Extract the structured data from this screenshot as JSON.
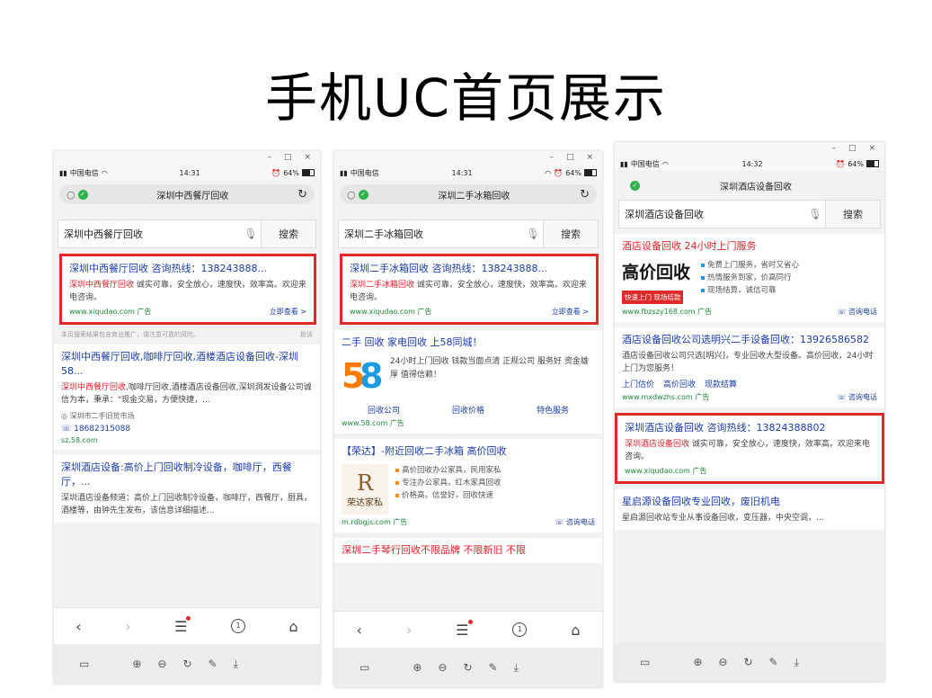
{
  "slide_title": "手机UC首页展示",
  "window_controls": {
    "min": "–",
    "max": "□",
    "close": "×"
  },
  "phones": [
    {
      "status": {
        "carrier": "中国电信",
        "time": "14:31",
        "battery": "64%"
      },
      "addr": "深圳中西餐厅回收",
      "search": {
        "query": "深圳中西餐厅回收",
        "button": "搜索"
      },
      "ad1": {
        "title": "深圳中西餐厅回收 咨询热线：138243888...",
        "desc_red": "深圳中西餐厅回收",
        "desc": " 诚实可靠，安全放心，速度快，效率高。欢迎来电咨询。",
        "url": "www.xiqudao.com",
        "ad": "广告",
        "link": "立即查看 >"
      },
      "notice": {
        "text": "本页搜索结果包含商业推广，请注意可靠的风险。",
        "action": "投诉"
      },
      "r2": {
        "title": "深圳中西餐厅回收,咖啡厅回收,酒楼酒店设备回收-深圳58...",
        "desc_red": "深圳中西餐厅回收",
        "desc": ",咖啡厅回收,酒楼酒店设备回收,深圳洞发设备公司诚信为本，秉承：\"现金交易，方便快捷，...",
        "loc": "深圳市二手旧货市场",
        "phone": "18682315088",
        "url": "sz.58.com"
      },
      "r3": {
        "title": "深圳酒店设备:高价上门回收制冷设备，咖啡厅，西餐厅，...",
        "desc": "深圳酒店设备频道：高价上门回收制冷设备，咖啡厅，西餐厅，厨具，酒楼等，由钟先生发布，该信息详细描述..."
      }
    },
    {
      "status": {
        "carrier": "中国电信",
        "time": "14:31",
        "battery": "64%"
      },
      "addr": "深圳二手冰箱回收",
      "search": {
        "query": "深圳二手冰箱回收",
        "button": "搜索"
      },
      "ad1": {
        "title": "深圳二手冰箱回收 咨询热线：138243888...",
        "desc_red": "深圳二手冰箱回收",
        "desc": " 诚实可靠，安全放心，速度快，效率高。欢迎来电咨询。",
        "url": "www.xiqudao.com",
        "ad": "广告",
        "link": "立即查看 >"
      },
      "r2": {
        "title": "二手 回收 家电回收 上58同城！",
        "desc": "24小时上门回收 钱款当面点清 正规公司 服务好 资金雄厚 值得信赖！",
        "links": [
          "回收公司",
          "回收价格",
          "特色服务"
        ],
        "url": "www.58.com",
        "ad": "广告"
      },
      "r3": {
        "title": "【荣达】-附近回收二手冰箱 高价回收",
        "logo_text": "荣达家私",
        "bullets": [
          "高价回收办公家具，民用家私",
          "专注办公家具，红木家具回收",
          "价格高，信誉好，回收快速"
        ],
        "url": "m.rdbgjs.com",
        "ad": "广告",
        "call": "咨询电话"
      },
      "r4": {
        "title": "深圳二手琴行回收不限品牌 不限新旧 不限"
      }
    },
    {
      "status": {
        "carrier": "中国电信",
        "time": "14:32",
        "battery": "64%"
      },
      "addr": "深圳酒店设备回收",
      "search": {
        "query": "深圳酒店设备回收",
        "button": "搜索"
      },
      "r1": {
        "title": "酒店设备回收 24小时上门服务",
        "big": "高价回收",
        "tag": "快速上门 现场结款",
        "bullets": [
          "免费上门服务，省时又省心",
          "热情服务到家，价高同行",
          "现场结算，诚信可靠"
        ],
        "url": "www.fbzszy168.com",
        "ad": "广告",
        "call": "咨询电话"
      },
      "r2": {
        "title": "酒店设备回收公司选明兴二手设备回收：13926586582",
        "desc": "酒店设备回收公司只选[明兴]，专业回收大型设备。高价回收，24小时上门为您服务！",
        "links": [
          "上门估价",
          "高价回收",
          "现款结算"
        ],
        "url": "www.mxdwzhs.com",
        "ad": "广告",
        "call": "咨询电话"
      },
      "ad1": {
        "title": "深圳酒店设备回收 咨询热线：13824388802",
        "desc_red": "深圳酒店设备回收",
        "desc": " 诚实可靠，安全放心，速度快，效率高。欢迎来电咨询。",
        "url": "www.xiqudao.com",
        "ad": "广告"
      },
      "r4": {
        "title": "星启源设备回收专业回收，废旧机电",
        "desc": "星启源回收站专业从事设备回收，变压器，中央空调，..."
      }
    }
  ]
}
